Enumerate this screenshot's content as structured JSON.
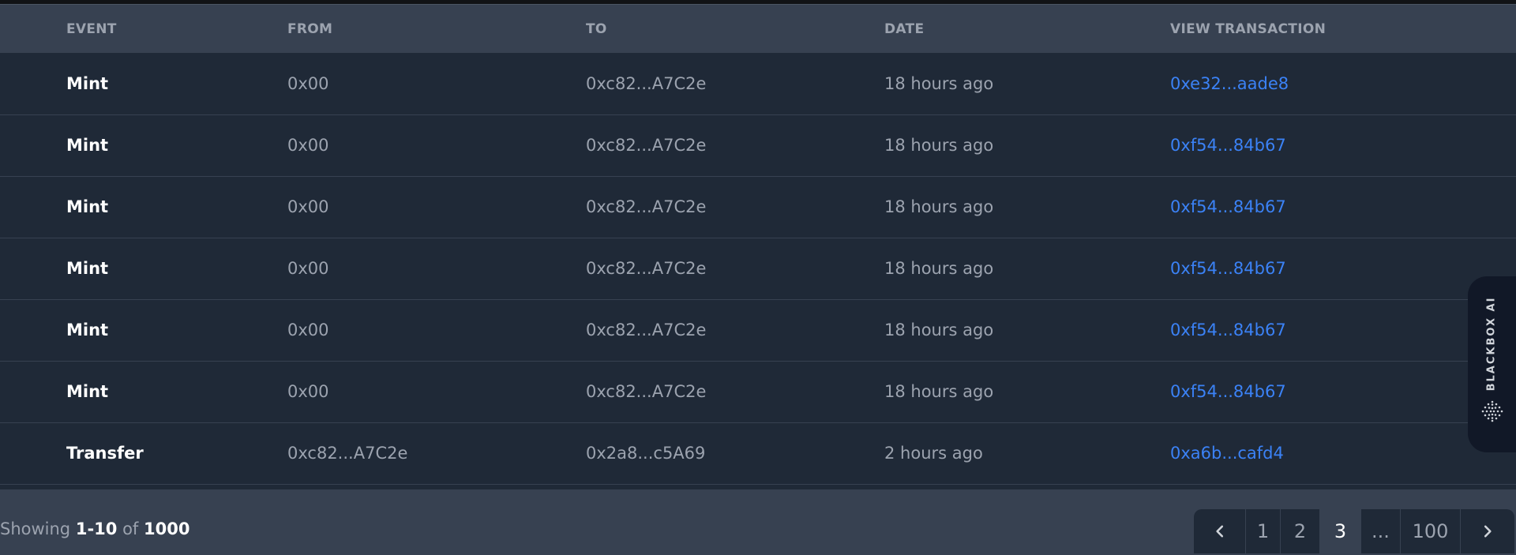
{
  "table": {
    "headers": {
      "event": "EVENT",
      "from": "FROM",
      "to": "TO",
      "date": "DATE",
      "view": "VIEW TRANSACTION"
    },
    "rows": [
      {
        "event": "Mint",
        "from": "0x00",
        "to": "0xc82...A7C2e",
        "date": "18 hours ago",
        "tx": "0xe32...aade8"
      },
      {
        "event": "Mint",
        "from": "0x00",
        "to": "0xc82...A7C2e",
        "date": "18 hours ago",
        "tx": "0xf54...84b67"
      },
      {
        "event": "Mint",
        "from": "0x00",
        "to": "0xc82...A7C2e",
        "date": "18 hours ago",
        "tx": "0xf54...84b67"
      },
      {
        "event": "Mint",
        "from": "0x00",
        "to": "0xc82...A7C2e",
        "date": "18 hours ago",
        "tx": "0xf54...84b67"
      },
      {
        "event": "Mint",
        "from": "0x00",
        "to": "0xc82...A7C2e",
        "date": "18 hours ago",
        "tx": "0xf54...84b67"
      },
      {
        "event": "Mint",
        "from": "0x00",
        "to": "0xc82...A7C2e",
        "date": "18 hours ago",
        "tx": "0xf54...84b67"
      },
      {
        "event": "Transfer",
        "from": "0xc82...A7C2e",
        "to": "0x2a8...c5A69",
        "date": "2 hours ago",
        "tx": "0xa6b...cafd4"
      }
    ]
  },
  "footer": {
    "showing_prefix": "Showing",
    "range": "1-10",
    "of_label": "of",
    "total": "1000"
  },
  "pagination": {
    "pages": [
      "1",
      "2",
      "3",
      "...",
      "100"
    ],
    "current": "3",
    "prev_icon": "chevron-left-icon",
    "next_icon": "chevron-right-icon"
  },
  "side_tab": {
    "label": "BLACKBOX AI",
    "icon": "blackbox-logo-icon"
  },
  "colors": {
    "background": "#1f2937",
    "header_bg": "#374151",
    "link": "#3b82f6",
    "text_muted": "#9ca3af",
    "text_strong": "#ffffff"
  }
}
